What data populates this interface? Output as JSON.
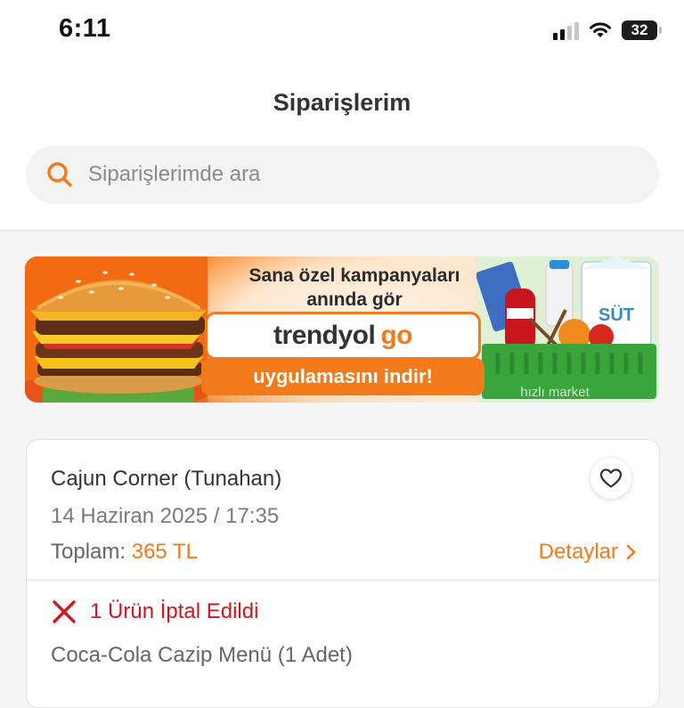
{
  "status_bar": {
    "time": "6:11",
    "battery": "32"
  },
  "header": {
    "title": "Siparişlerim"
  },
  "search": {
    "placeholder": "Siparişlerimde ara"
  },
  "banner": {
    "line1": "Sana özel kampanyaları",
    "line2": "anında gör",
    "brand_part1": "trendyol",
    "brand_part2": "go",
    "cta": "uygulamasını indir!",
    "milk_label": "SÜT",
    "basket_text": "hızlı market"
  },
  "order": {
    "restaurant": "Cajun Corner (Tunahan)",
    "date": "14 Haziran 2025 / 17:35",
    "total_label": "Toplam:",
    "total_value": "365 TL",
    "details_label": "Detaylar",
    "cancel_status": "1 Ürün İptal Edildi",
    "item": "Coca-Cola Cazip Menü (1 Adet)"
  },
  "colors": {
    "accent": "#f27a1a",
    "danger": "#d0161f"
  },
  "icons": [
    "signal-icon",
    "wifi-icon",
    "battery-icon",
    "search-icon",
    "heart-icon",
    "chevron-right-icon",
    "close-icon"
  ]
}
